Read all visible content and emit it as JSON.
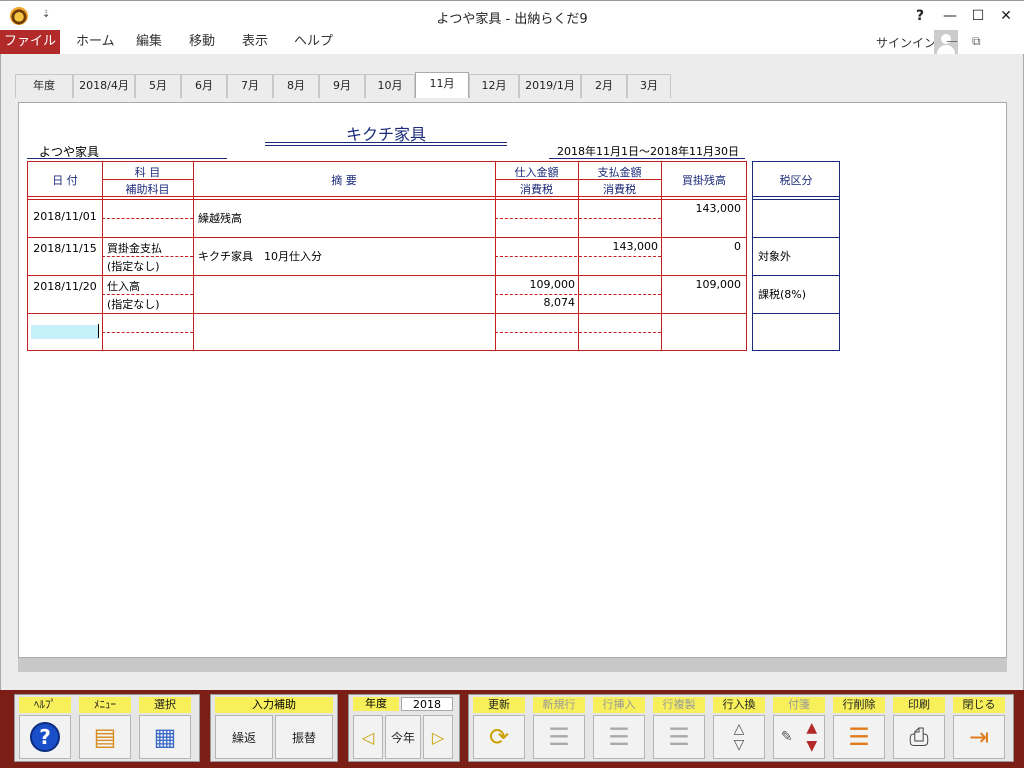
{
  "window": {
    "title": "よつや家具 - 出納らくだ9",
    "qa_arrow": "⇣",
    "help_btn": "?",
    "minimize_btn": "—",
    "maximize_btn": "☐",
    "close_btn": "✕"
  },
  "menu": {
    "file": "ファイル",
    "home": "ホーム",
    "edit": "編集",
    "move": "移動",
    "view": "表示",
    "help": "ヘルプ",
    "signin": "サインイン",
    "ribbon_min": "—",
    "ribbon_restore": "⧉"
  },
  "tabs": [
    "年度",
    "2018/4月",
    "5月",
    "6月",
    "7月",
    "8月",
    "9月",
    "10月",
    "11月",
    "12月",
    "2019/1月",
    "2月",
    "3月"
  ],
  "active_tab": "11月",
  "ledger": {
    "company": "よつや家具",
    "title": "キクチ家具",
    "period": "2018年11月1日～2018年11月30日",
    "headers": {
      "date": "日 付",
      "account": "科 目",
      "sub_account": "補助科目",
      "description": "摘 要",
      "purchase": "仕入金額",
      "purchase_tax": "消費税",
      "payment": "支払金額",
      "payment_tax": "消費税",
      "balance": "買掛残高",
      "tax_class": "税区分"
    },
    "rows": [
      {
        "date": "2018/11/01",
        "account": "",
        "sub_account": "",
        "description": "繰越残高",
        "purchase": "",
        "purchase_tax": "",
        "payment": "",
        "payment_tax": "",
        "balance": "143,000",
        "tax_class": ""
      },
      {
        "date": "2018/11/15",
        "account": "買掛金支払",
        "sub_account": "(指定なし)",
        "description": "キクチ家具　10月仕入分",
        "purchase": "",
        "purchase_tax": "",
        "payment": "143,000",
        "payment_tax": "",
        "balance": "0",
        "tax_class": "対象外"
      },
      {
        "date": "2018/11/20",
        "account": "仕入高",
        "sub_account": "(指定なし)",
        "description": "",
        "purchase": "109,000",
        "purchase_tax": "8,074",
        "payment": "",
        "payment_tax": "",
        "balance": "109,000",
        "tax_class": "課税(8%)"
      }
    ]
  },
  "toolbar": {
    "help": "ﾍﾙﾌﾟ",
    "menu": "ﾒﾆｭｰ",
    "select": "選択",
    "input_assist": "入力補助",
    "carry": "繰返",
    "transfer": "振替",
    "year_label": "年度",
    "year_value": "2018",
    "this_year": "今年",
    "refresh": "更新",
    "new_row": "新規行",
    "insert_row": "行挿入",
    "copy_row": "行複製",
    "swap_row": "行入換",
    "sticky": "付箋",
    "delete_row": "行削除",
    "print": "印刷",
    "close": "閉じる"
  },
  "colors": {
    "file_menu": "#b22a2a",
    "toolbar_bg": "#7a1e16",
    "grid_red": "#c41e1e",
    "navy": "#1a2a7a",
    "label_yellow": "#f7f05a",
    "cursor_cyan": "#c6f0f7"
  }
}
